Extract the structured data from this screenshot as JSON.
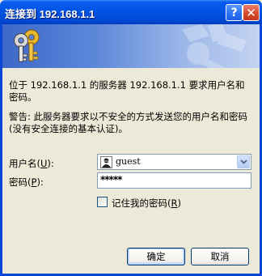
{
  "window": {
    "title": "连接到 192.168.1.1",
    "help_glyph": "?",
    "close_glyph": "✕"
  },
  "banner": {
    "icon": "keys-icon"
  },
  "messages": {
    "main": "位于 192.168.1.1 的服务器 192.168.1.1 要求用户名和密码。",
    "warning": "警告: 此服务器要求以不安全的方式发送您的用户名和密码(没有安全连接的基本认证)。"
  },
  "form": {
    "username_label": "用户名(",
    "username_key": "U",
    "username_suffix": "):",
    "username_value": "guest",
    "password_label": "密码(",
    "password_key": "P",
    "password_suffix": "):",
    "password_value": "*****",
    "remember_label": "记住我的密码(",
    "remember_key": "R",
    "remember_suffix": ")",
    "remember_checked": false
  },
  "buttons": {
    "ok": "确定",
    "cancel": "取消"
  },
  "colors": {
    "titlebar": "#0054e3",
    "dialog_bg": "#ece9d8",
    "banner_start": "#3e68c8",
    "banner_end": "#c3d3f1"
  }
}
